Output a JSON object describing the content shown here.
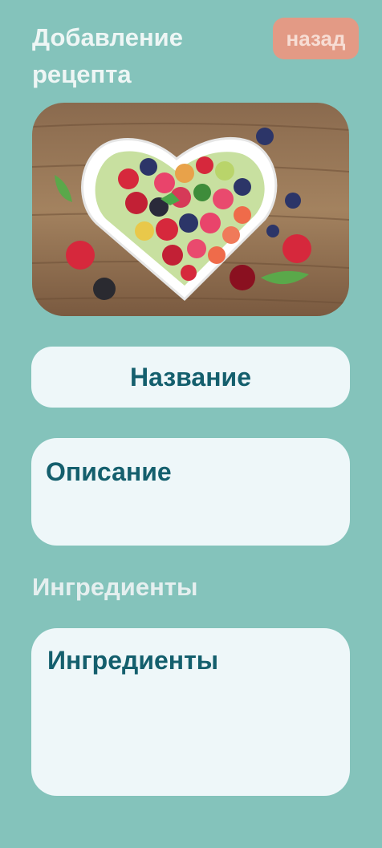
{
  "header": {
    "title": "Добавление рецепта",
    "back_label": "назад"
  },
  "hero": {
    "icon": "fruit-salad-image"
  },
  "form": {
    "name_placeholder": "Название",
    "description_placeholder": "Описание",
    "ingredients_section_label": "Ингредиенты",
    "ingredients_placeholder": "Ингредиенты"
  },
  "colors": {
    "background": "#84c3bb",
    "field_bg": "#eef7f9",
    "field_text": "#145f6d",
    "back_button_bg": "#e39a85"
  }
}
